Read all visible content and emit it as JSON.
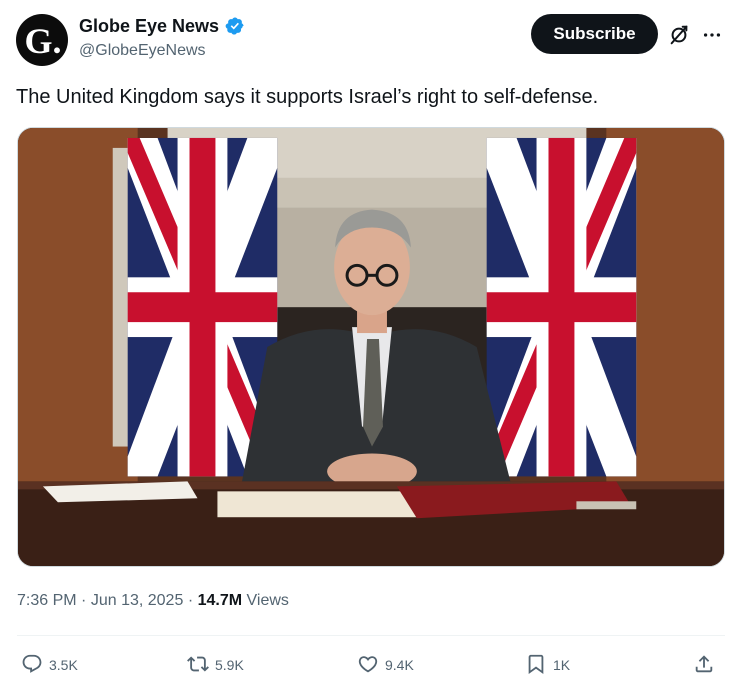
{
  "author": {
    "avatar_letter": "G.",
    "display_name": "Globe Eye News",
    "handle": "@GlobeEyeNews",
    "verified": true
  },
  "header": {
    "subscribe_label": "Subscribe"
  },
  "tweet": {
    "text": "The United Kingdom says it supports Israel’s right to self-defense."
  },
  "meta": {
    "time": "7:36 PM",
    "separator": "·",
    "date": "Jun 13, 2025",
    "views_count": "14.7M",
    "views_label": "Views"
  },
  "actions": {
    "replies": "3.5K",
    "reposts": "5.9K",
    "likes": "9.4K",
    "bookmarks": "1K"
  },
  "colors": {
    "verified": "#1d9bf0",
    "text_primary": "#0f1419",
    "text_secondary": "#536471",
    "button_bg": "#0f1419"
  },
  "icons": [
    "verified-badge-icon",
    "grok-icon",
    "more-icon",
    "reply-icon",
    "repost-icon",
    "like-icon",
    "bookmark-icon",
    "share-icon"
  ]
}
